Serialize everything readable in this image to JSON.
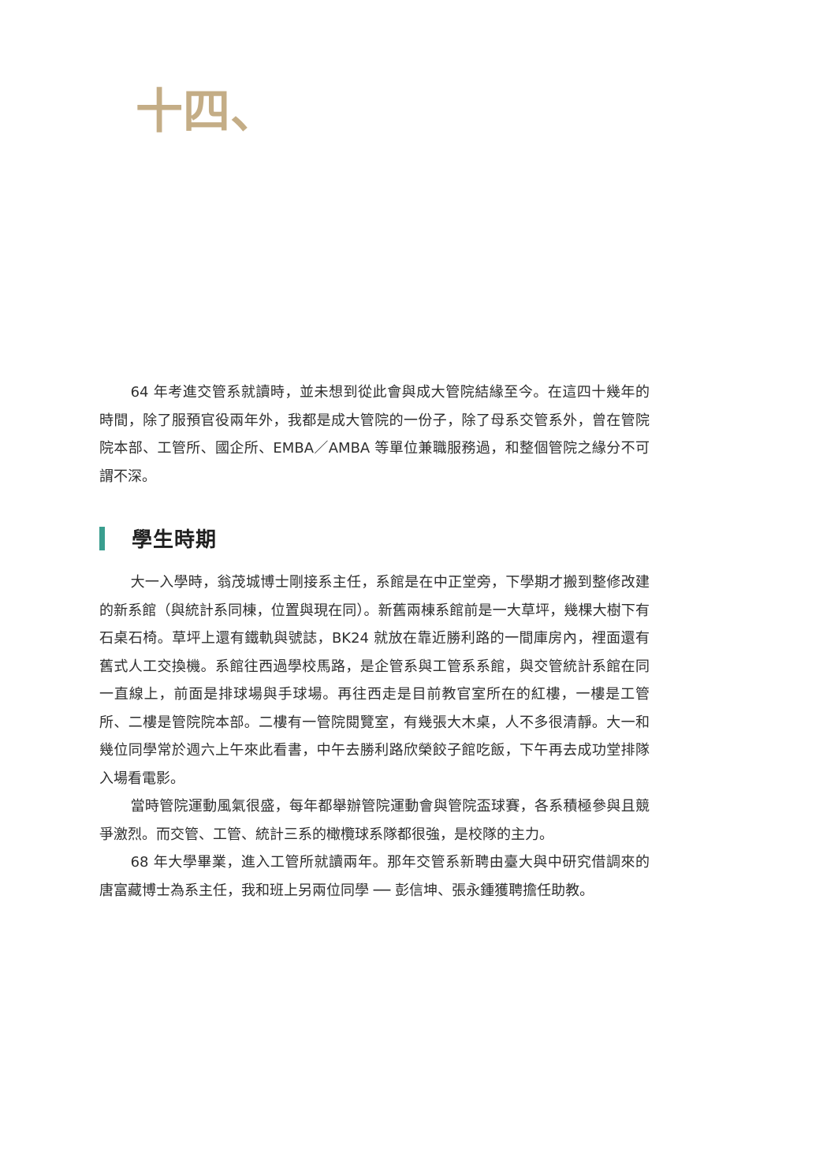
{
  "chapter": {
    "number": "十四、"
  },
  "intro": {
    "paragraph": "64 年考進交管系就讀時，並未想到從此會與成大管院結緣至今。在這四十幾年的時間，除了服預官役兩年外，我都是成大管院的一份子，除了母系交管系外，曾在管院院本部、工管所、國企所、EMBA／AMBA 等單位兼職服務過，和整個管院之緣分不可謂不深。"
  },
  "section": {
    "heading": "學生時期",
    "paragraphs": [
      "大一入學時，翁茂城博士剛接系主任，系館是在中正堂旁，下學期才搬到整修改建的新系館（與統計系同棟，位置與現在同）。新舊兩棟系館前是一大草坪，幾棵大樹下有石桌石椅。草坪上還有鐵軌與號誌，BK24 就放在靠近勝利路的一間庫房內，裡面還有舊式人工交換機。系館往西過學校馬路，是企管系與工管系系館，與交管統計系館在同一直線上，前面是排球場與手球場。再往西走是目前教官室所在的紅樓，一樓是工管所、二樓是管院院本部。二樓有一管院閱覽室，有幾張大木桌，人不多很清靜。大一和幾位同學常於週六上午來此看書，中午去勝利路欣榮餃子館吃飯，下午再去成功堂排隊入場看電影。",
      "當時管院運動風氣很盛，每年都舉辦管院運動會與管院盃球賽，各系積極參與且競爭激烈。而交管、工管、統計三系的橄欖球系隊都很強，是校隊的主力。",
      "68 年大學畢業，進入工管所就讀兩年。那年交管系新聘由臺大與中研究借調來的唐富藏博士為系主任，我和班上另兩位同學 ── 彭信坤、張永鍾獲聘擔任助教。"
    ]
  },
  "colors": {
    "chapter_number": "#c4ad86",
    "heading_bar": "#3a9e8f",
    "body_text": "#2e2e2e"
  }
}
